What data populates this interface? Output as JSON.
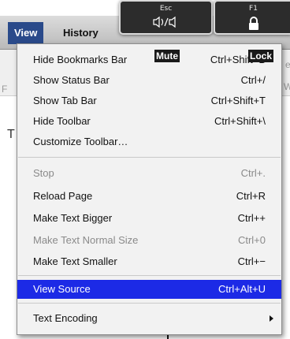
{
  "menubar": {
    "items": [
      {
        "label": "View"
      },
      {
        "label": "History"
      }
    ]
  },
  "background_fragments": {
    "right_edge_a": "e",
    "right_edge_b": "W",
    "left_edge": "F",
    "left_cursor": "T"
  },
  "key_overlays": [
    {
      "label": "Esc",
      "icon": "speaker-mute-icon",
      "tooltip": "Mute"
    },
    {
      "label": "F1",
      "icon": "lock-icon",
      "tooltip": "Lock"
    }
  ],
  "menu": {
    "items": [
      {
        "label": "Hide Bookmarks Bar",
        "shortcut": "Ctrl+Shift+B",
        "state": "normal"
      },
      {
        "label": "Show Status Bar",
        "shortcut": "Ctrl+/",
        "state": "normal"
      },
      {
        "label": "Show Tab Bar",
        "shortcut": "Ctrl+Shift+T",
        "state": "normal"
      },
      {
        "label": "Hide Toolbar",
        "shortcut": "Ctrl+Shift+\\",
        "state": "normal"
      },
      {
        "label": "Customize Toolbar…",
        "shortcut": "",
        "state": "normal"
      },
      {
        "label": "Stop",
        "shortcut": "Ctrl+.",
        "state": "disabled"
      },
      {
        "label": "Reload Page",
        "shortcut": "Ctrl+R",
        "state": "normal"
      },
      {
        "label": "Make Text Bigger",
        "shortcut": "Ctrl++",
        "state": "normal"
      },
      {
        "label": "Make Text Normal Size",
        "shortcut": "Ctrl+0",
        "state": "disabled"
      },
      {
        "label": "Make Text Smaller",
        "shortcut": "Ctrl+−",
        "state": "normal"
      },
      {
        "label": "View Source",
        "shortcut": "Ctrl+Alt+U",
        "state": "highlighted"
      },
      {
        "label": "Text Encoding",
        "shortcut": "",
        "state": "submenu"
      }
    ]
  },
  "colors": {
    "highlight": "#1c2ae6",
    "menubar_active": "#2a4a8a"
  }
}
